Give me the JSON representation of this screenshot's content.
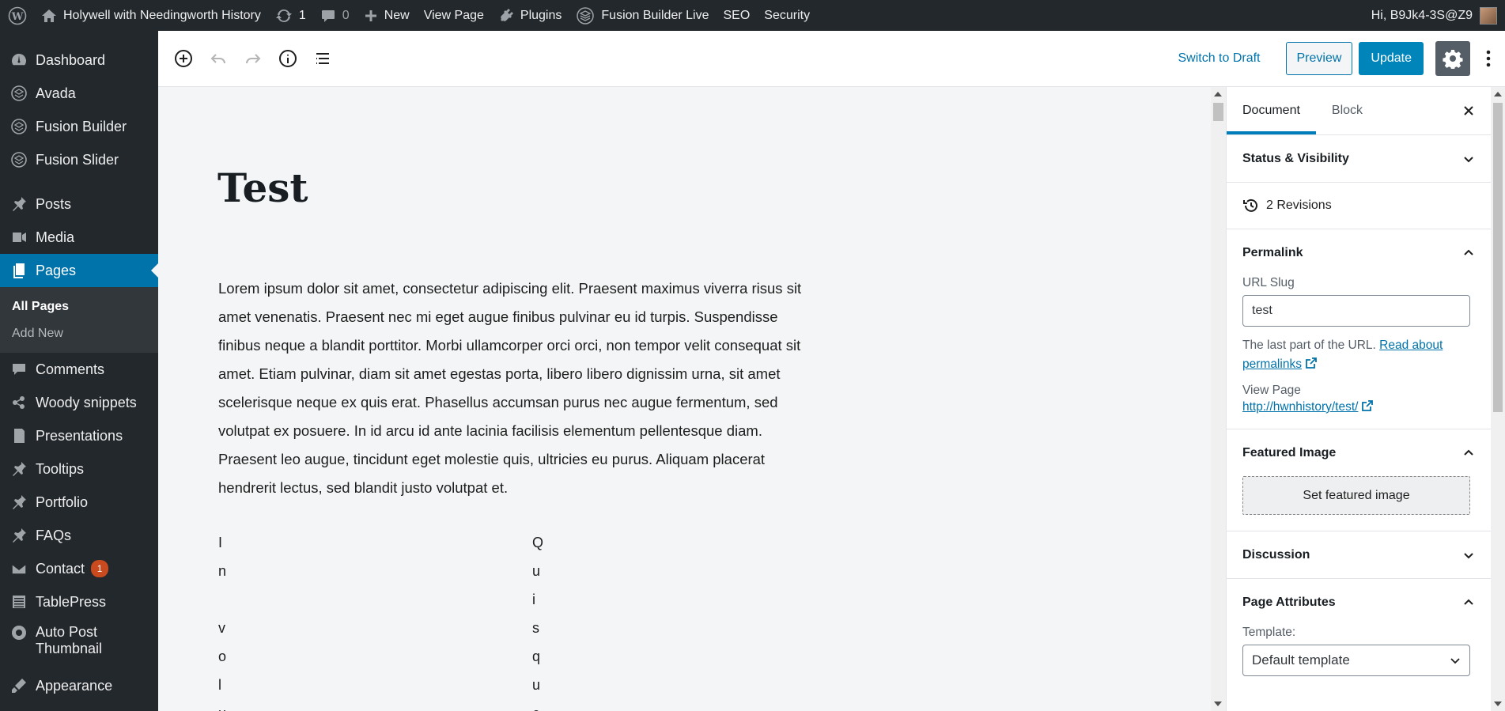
{
  "admin_bar": {
    "site_name": "Holywell with Needingworth History",
    "updates_count": "1",
    "comments_count": "0",
    "new_label": "New",
    "view_page": "View Page",
    "plugins": "Plugins",
    "fusion_live": "Fusion Builder Live",
    "seo": "SEO",
    "security": "Security",
    "greeting": "Hi, B9Jk4-3S@Z9"
  },
  "sidebar": {
    "items": [
      {
        "label": "Dashboard",
        "icon": "dashboard-icon"
      },
      {
        "label": "Avada",
        "icon": "avada-icon"
      },
      {
        "label": "Fusion Builder",
        "icon": "fusion-builder-icon"
      },
      {
        "label": "Fusion Slider",
        "icon": "fusion-slider-icon"
      },
      {
        "label": "Posts",
        "icon": "pin-icon"
      },
      {
        "label": "Media",
        "icon": "media-icon"
      },
      {
        "label": "Pages",
        "icon": "pages-icon"
      },
      {
        "label": "Comments",
        "icon": "comments-icon"
      },
      {
        "label": "Woody snippets",
        "icon": "snippets-icon"
      },
      {
        "label": "Presentations",
        "icon": "presentations-icon"
      },
      {
        "label": "Tooltips",
        "icon": "pin-icon"
      },
      {
        "label": "Portfolio",
        "icon": "pin-icon"
      },
      {
        "label": "FAQs",
        "icon": "pin-icon"
      },
      {
        "label": "Contact",
        "icon": "mail-icon",
        "badge": "1"
      },
      {
        "label": "TablePress",
        "icon": "table-icon"
      },
      {
        "label": "Auto Post",
        "label2": "Thumbnail",
        "icon": "thumbnail-icon"
      },
      {
        "label": "Appearance",
        "icon": "appearance-icon"
      }
    ],
    "submenu": [
      "All Pages",
      "Add New"
    ]
  },
  "toolbar": {
    "switch_to_draft": "Switch to Draft",
    "preview": "Preview",
    "update": "Update"
  },
  "editor": {
    "title": "Test",
    "paragraph": "Lorem ipsum dolor sit amet, consectetur adipiscing elit. Praesent maximus viverra risus sit amet venenatis. Praesent nec mi eget augue finibus pulvinar eu id turpis. Suspendisse finibus neque a blandit porttitor. Morbi ullamcorper orci orci, non tempor velit consequat sit amet. Etiam pulvinar, diam sit amet egestas porta, libero libero dignissim urna, sit amet scelerisque neque ex quis erat. Phasellus accumsan purus nec augue fermentum, sed volutpat ex posuere. In id arcu id ante lacinia facilisis elementum pellentesque diam. Praesent leo augue, tincidunt eget molestie quis, ultricies eu purus. Aliquam placerat hendrerit lectus, sed blandit justo volutpat et.",
    "col1": [
      "I",
      "n",
      "",
      "v",
      "o",
      "l",
      "u"
    ],
    "col2": [
      "Q",
      "u",
      "i",
      "s",
      "q",
      "u",
      "e"
    ]
  },
  "settings": {
    "tab_document": "Document",
    "tab_block": "Block",
    "status_visibility": "Status & Visibility",
    "revisions": "2 Revisions",
    "permalink": "Permalink",
    "url_slug_label": "URL Slug",
    "url_slug_value": "test",
    "help_text": "The last part of the URL.",
    "read_about": "Read about",
    "permalinks": "permalinks",
    "view_page_label": "View Page",
    "view_page_url": "http://hwnhistory/test/",
    "featured_image": "Featured Image",
    "set_featured_image": "Set featured image",
    "discussion": "Discussion",
    "page_attributes": "Page Attributes",
    "template_label": "Template:",
    "template_value": "Default template"
  },
  "colors": {
    "admin_bg": "#23282d",
    "accent": "#0073aa",
    "update_btn": "#0085ba",
    "badge": "#ca4a1f"
  }
}
